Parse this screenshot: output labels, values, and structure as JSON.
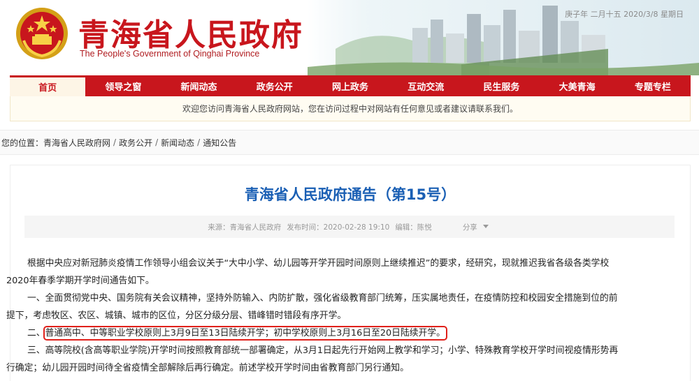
{
  "header": {
    "title_cn": "青海省人民政府",
    "title_en": "The People's Government of Qinghai Province",
    "date": "庚子年 二月十五 2020/3/8 星期日"
  },
  "nav": {
    "items": [
      {
        "label": "首页"
      },
      {
        "label": "领导之窗"
      },
      {
        "label": "新闻动态"
      },
      {
        "label": "政务公开"
      },
      {
        "label": "网上政务"
      },
      {
        "label": "互动交流"
      },
      {
        "label": "民生服务"
      },
      {
        "label": "大美青海"
      },
      {
        "label": "专题专栏"
      }
    ],
    "active_index": 0,
    "color": "#c8161d"
  },
  "welcome": "欢迎您访问青海省人民政府网站，您在访问过程中对网站有任何意见或者建议请联系我们。",
  "breadcrumb": {
    "prefix": "您的位置：",
    "items": [
      "青海省人民政府网",
      "政务公开",
      "新闻动态",
      "通知公告"
    ]
  },
  "article": {
    "title": "青海省人民政府通告（第15号）",
    "meta": {
      "source": "来源：青海省人民政府",
      "published": "发布时间：2020-02-28 19:10",
      "editor": "编辑：陈悦",
      "share": "分享"
    },
    "paragraphs": {
      "p1_line1": "根据中央应对新冠肺炎疫情工作领导小组会议关于“大中小学、幼儿园等开学开园时间原则上继续推迟”的要求，经研究，现就推迟我省各级各类学校",
      "p1_line2": "2020年春季学期开学时间通告如下。",
      "p2_line1": "一、全面贯彻党中央、国务院有关会议精神，坚持外防输入、内防扩散，强化省级教育部门统筹，压实属地责任，在疫情防控和校园安全措施到位的前",
      "p2_line2": "提下，考虑牧区、农区、城镇、城市的区位，分区分级分层、错峰错时错段有序开学。",
      "p3_prefix": "二、",
      "p3_highlight": "普通高中、中等职业学校原则上3月9日至13日陆续开学；初中学校原则上3月16日至20日陆续开学。",
      "p4_line1": "三、高等院校(含高等职业学院)开学时间按照教育部统一部署确定，从3月1日起先行开始网上教学和学习；小学、特殊教育学校开学时间视疫情形势再",
      "p4_line2": "行确定；幼儿园开园时间待全省疫情全部解除后再行确定。前述学校开学时间由省教育部门另行通知。"
    },
    "highlight_color": "#e0201a",
    "title_color": "#1a5fb4"
  }
}
